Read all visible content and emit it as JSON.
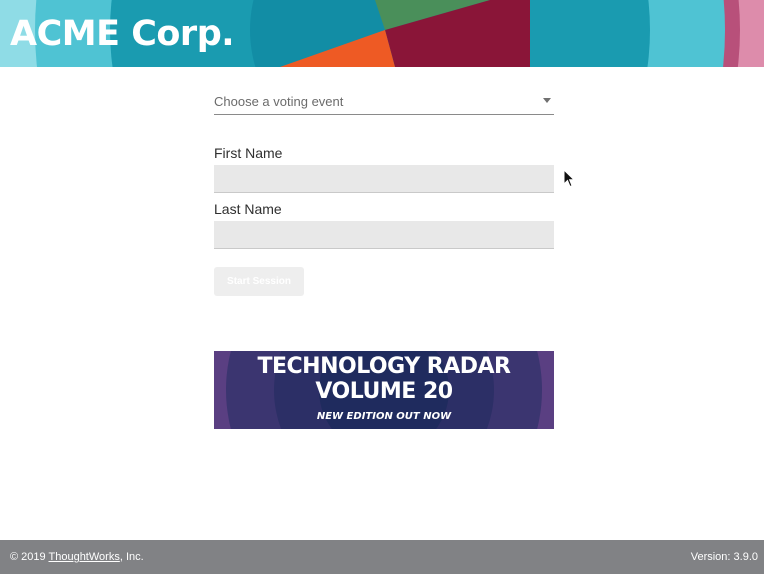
{
  "header": {
    "brand": "ACME Corp."
  },
  "form": {
    "voting_event_placeholder": "Choose a voting event",
    "first_name_label": "First Name",
    "first_name_value": "",
    "last_name_label": "Last Name",
    "last_name_value": "",
    "start_button_label": "Start Session"
  },
  "banner": {
    "line1": "TECHNOLOGY RADAR",
    "line2": "VOLUME 20",
    "subtitle": "NEW EDITION OUT NOW"
  },
  "footer": {
    "copyright_prefix": "© 2019 ",
    "company_link": "ThoughtWorks",
    "copyright_suffix": ", Inc.",
    "version": "Version: 3.9.0"
  },
  "colors": {
    "footer_bg": "#818285",
    "banner_bg": "#3b3570",
    "teal": "#1a9bb0",
    "dark_red": "#8a1538",
    "pink": "#b8507a",
    "orange": "#ee5a24",
    "green": "#4a8f5a"
  },
  "icons": {
    "select_arrow": "chevron-down-icon",
    "cursor": "mouse-pointer-icon"
  }
}
